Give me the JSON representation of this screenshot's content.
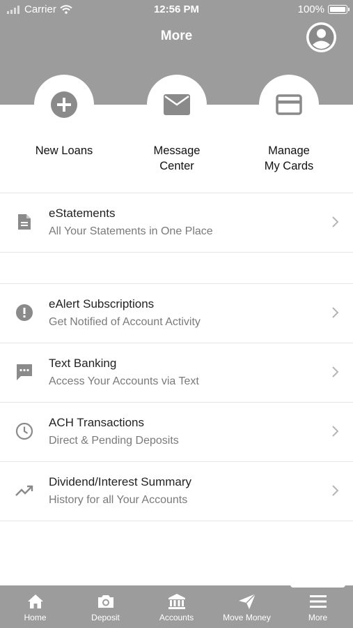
{
  "status_bar": {
    "carrier": "Carrier",
    "time": "12:56 PM",
    "battery": "100%"
  },
  "header": {
    "title": "More"
  },
  "quick_actions": [
    {
      "label": "New Loans",
      "icon": "plus-circle-icon"
    },
    {
      "label": "Message\nCenter",
      "icon": "envelope-icon"
    },
    {
      "label": "Manage\nMy Cards",
      "icon": "credit-card-icon"
    }
  ],
  "menu": [
    {
      "title": "eStatements",
      "subtitle": "All Your Statements in One Place",
      "icon": "document-icon"
    },
    {
      "title": "eAlert Subscriptions",
      "subtitle": "Get Notified of Account Activity",
      "icon": "alert-icon"
    },
    {
      "title": "Text Banking",
      "subtitle": "Access Your Accounts via Text",
      "icon": "chat-icon"
    },
    {
      "title": "ACH Transactions",
      "subtitle": "Direct & Pending Deposits",
      "icon": "clock-icon"
    },
    {
      "title": "Dividend/Interest Summary",
      "subtitle": "History for all Your Accounts",
      "icon": "trending-up-icon"
    }
  ],
  "tabbar": {
    "items": [
      {
        "label": "Home",
        "icon": "home-icon"
      },
      {
        "label": "Deposit",
        "icon": "camera-icon"
      },
      {
        "label": "Accounts",
        "icon": "bank-icon"
      },
      {
        "label": "Move Money",
        "icon": "send-icon"
      },
      {
        "label": "More",
        "icon": "menu-icon"
      }
    ],
    "active": "More"
  },
  "colors": {
    "header": "#9c9c9c",
    "icon": "#8a8a8a",
    "chevron": "#b5b5b5"
  }
}
